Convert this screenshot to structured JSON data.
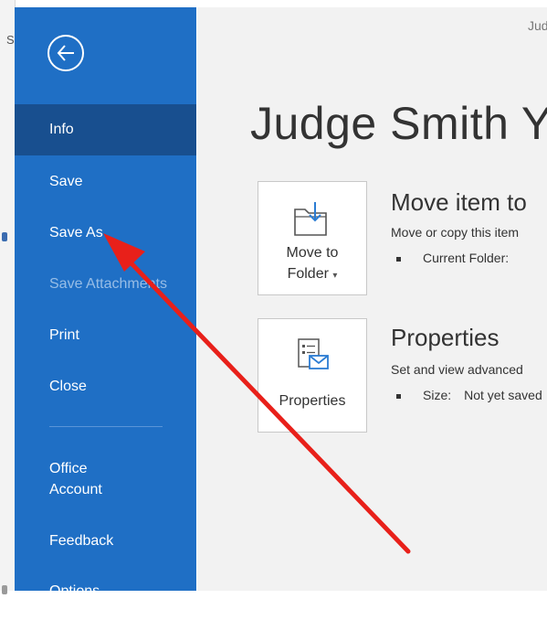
{
  "background_window": {
    "letter": "S"
  },
  "nav": {
    "back_icon": "back-arrow-icon",
    "items": [
      {
        "label": "Info",
        "state": "active"
      },
      {
        "label": "Save",
        "state": "normal"
      },
      {
        "label": "Save As",
        "state": "normal"
      },
      {
        "label": "Save Attachments",
        "state": "disabled"
      },
      {
        "label": "Print",
        "state": "normal"
      },
      {
        "label": "Close",
        "state": "normal"
      }
    ],
    "bottom_items": [
      {
        "label_line1": "Office",
        "label_line2": "Account"
      },
      {
        "label": "Feedback"
      },
      {
        "label": "Options"
      }
    ]
  },
  "main": {
    "doc_title_small": "Judge Smith",
    "page_title": "Judge Smith Y",
    "move_section": {
      "button_line1": "Move to",
      "button_line2": "Folder",
      "button_caret": "▾",
      "title": "Move item to",
      "description": "Move or copy this item",
      "bullet_key": "Current Folder:",
      "bullet_value": ""
    },
    "properties_section": {
      "button_label": "Properties",
      "title": "Properties",
      "description": "Set and view advanced",
      "bullet_key": "Size:",
      "bullet_value": "Not yet saved"
    }
  },
  "colors": {
    "nav_bg": "#1f6fc5",
    "nav_active": "#184f8f",
    "nav_disabled_text": "#97bde6",
    "main_bg": "#f2f2f2",
    "annotation_arrow": "#e8201a"
  },
  "annotation": {
    "type": "arrow",
    "points_to": "Save As"
  }
}
